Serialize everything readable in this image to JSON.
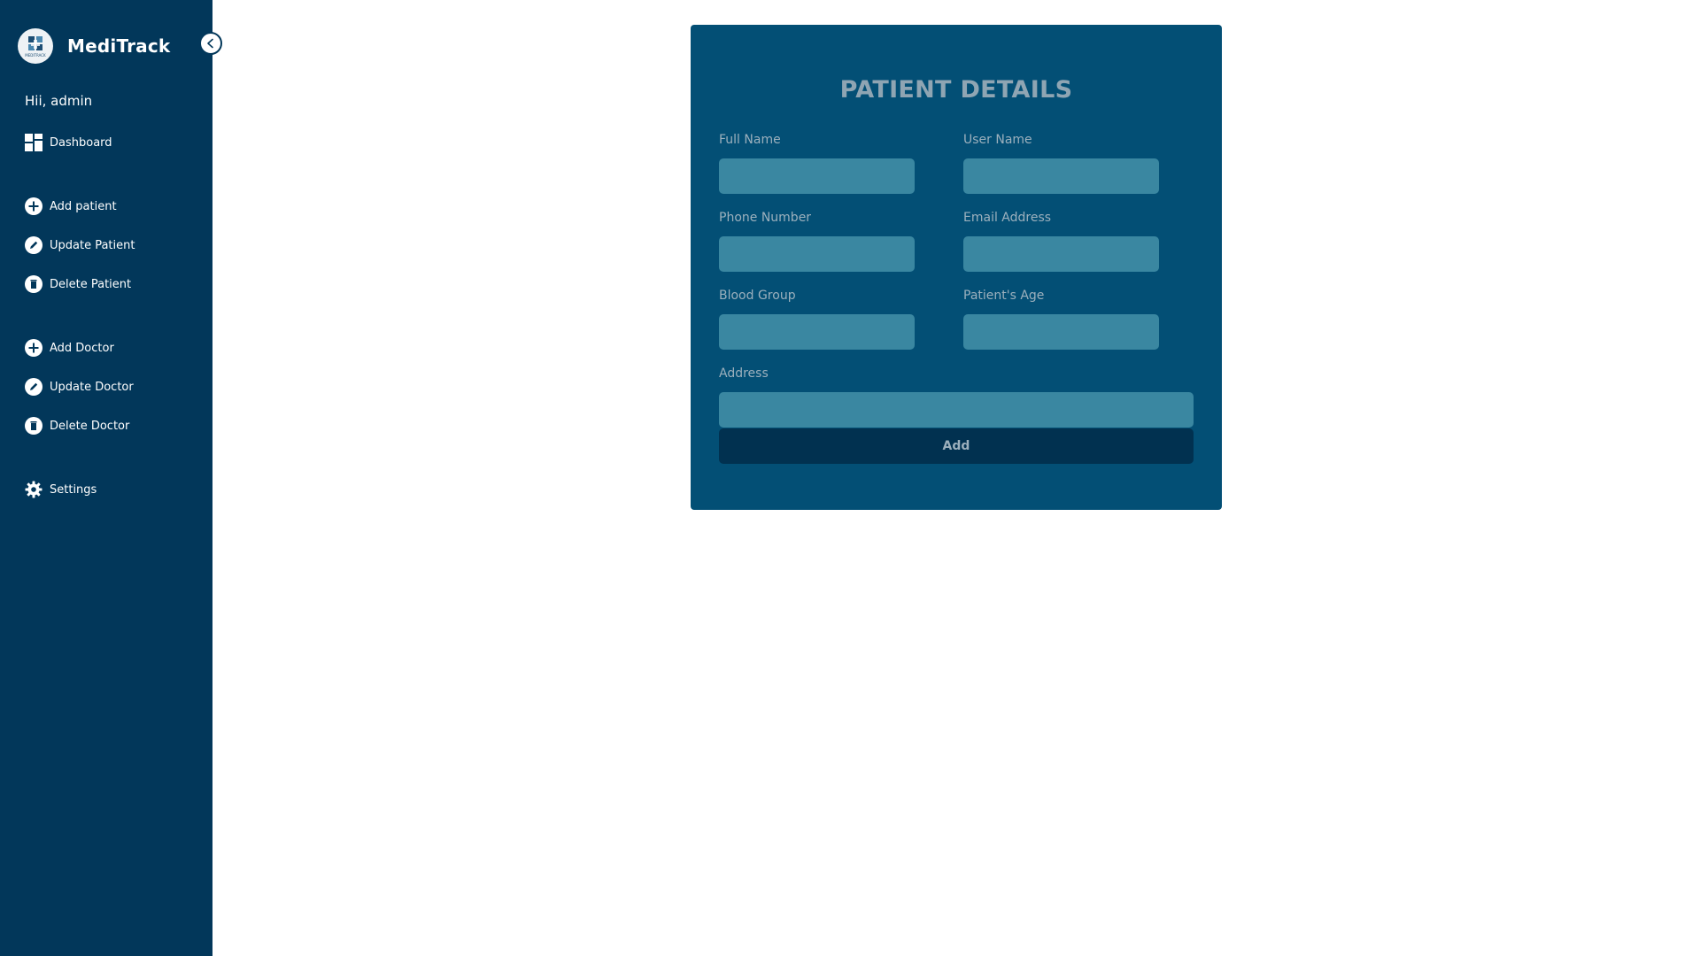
{
  "app": {
    "name": "MediTrack",
    "logo_text": "MEDITRACK"
  },
  "sidebar": {
    "greeting": "Hii, admin",
    "items": [
      {
        "label": "Dashboard",
        "icon": "dashboard-icon"
      },
      {
        "label": "Add patient",
        "icon": "plus-circle-icon"
      },
      {
        "label": "Update Patient",
        "icon": "pencil-circle-icon"
      },
      {
        "label": "Delete Patient",
        "icon": "trash-circle-icon"
      },
      {
        "label": "Add Doctor",
        "icon": "plus-circle-icon"
      },
      {
        "label": "Update Doctor",
        "icon": "pencil-circle-icon"
      },
      {
        "label": "Delete Doctor",
        "icon": "trash-circle-icon"
      },
      {
        "label": "Settings",
        "icon": "gear-icon"
      }
    ]
  },
  "form": {
    "title": "PATIENT DETAILS",
    "fields": {
      "full_name": {
        "label": "Full Name",
        "value": ""
      },
      "user_name": {
        "label": "User Name",
        "value": ""
      },
      "phone_number": {
        "label": "Phone Number",
        "value": ""
      },
      "email_address": {
        "label": "Email Address",
        "value": ""
      },
      "blood_group": {
        "label": "Blood Group",
        "value": ""
      },
      "patient_age": {
        "label": "Patient's Age",
        "value": ""
      },
      "address": {
        "label": "Address",
        "value": ""
      }
    },
    "submit_label": "Add"
  },
  "colors": {
    "sidebar_bg": "#02375a",
    "card_bg": "#034f75",
    "input_bg": "#3a87a1",
    "button_bg": "#013150",
    "label_text": "#9cb0bd"
  }
}
